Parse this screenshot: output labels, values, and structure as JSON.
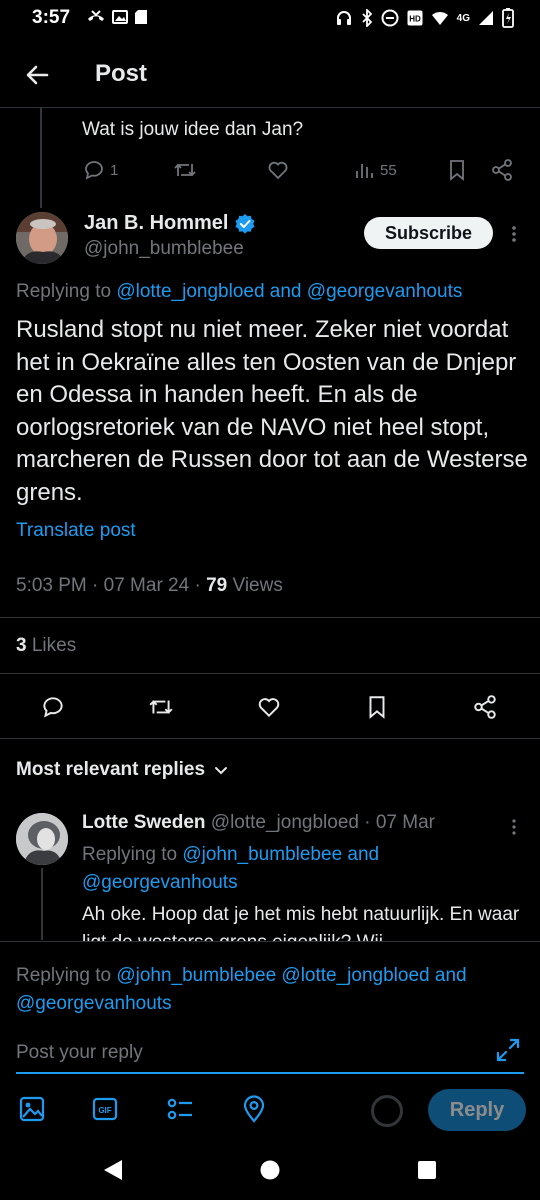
{
  "status_bar": {
    "time": "3:57",
    "network": "4G"
  },
  "header": {
    "title": "Post"
  },
  "previous_reply": {
    "text": "Wat is jouw idee dan Jan?",
    "reply_count": "1",
    "view_count": "55"
  },
  "tweet": {
    "author_name": "Jan B. Hommel",
    "author_handle": "@john_bumblebee",
    "subscribe_label": "Subscribe",
    "replying_prefix": "Replying to ",
    "replying_handles": "@lotte_jongbloed and @georgevanhouts",
    "body": "Rusland stopt nu niet meer. Zeker niet voordat het in Oekraïne alles ten Oosten van de Dnjepr en Odessa in handen heeft. En als de oorlogsretoriek van de NAVO niet heel stopt, marcheren de Russen door tot aan de Westerse grens.",
    "translate_label": "Translate post",
    "timestamp": "5:03 PM · 07 Mar 24 · ",
    "views_count": "79",
    "views_label": " Views",
    "likes_count": "3",
    "likes_label": " Likes"
  },
  "replies": {
    "sort_label": "Most relevant replies",
    "items": [
      {
        "name": "Lotte Sweden",
        "handle_date": " @lotte_jongbloed · 07 Mar",
        "replying_prefix": "Replying to ",
        "replying_handles": "@john_bumblebee and @georgevanhouts",
        "text": "Ah oke. Hoop dat je het mis hebt natuurlijk. En waar ligt de westerse grens eigenlijk? Wij"
      }
    ]
  },
  "composer": {
    "replying_prefix": "Replying to ",
    "replying_handles": "@john_bumblebee @lotte_jongbloed and @georgevanhouts",
    "placeholder": "Post your reply",
    "reply_label": "Reply"
  },
  "colors": {
    "background": "#000000",
    "accent": "#1d9bf0",
    "verified": "#1d9bf0",
    "muted_text": "#71767b"
  }
}
